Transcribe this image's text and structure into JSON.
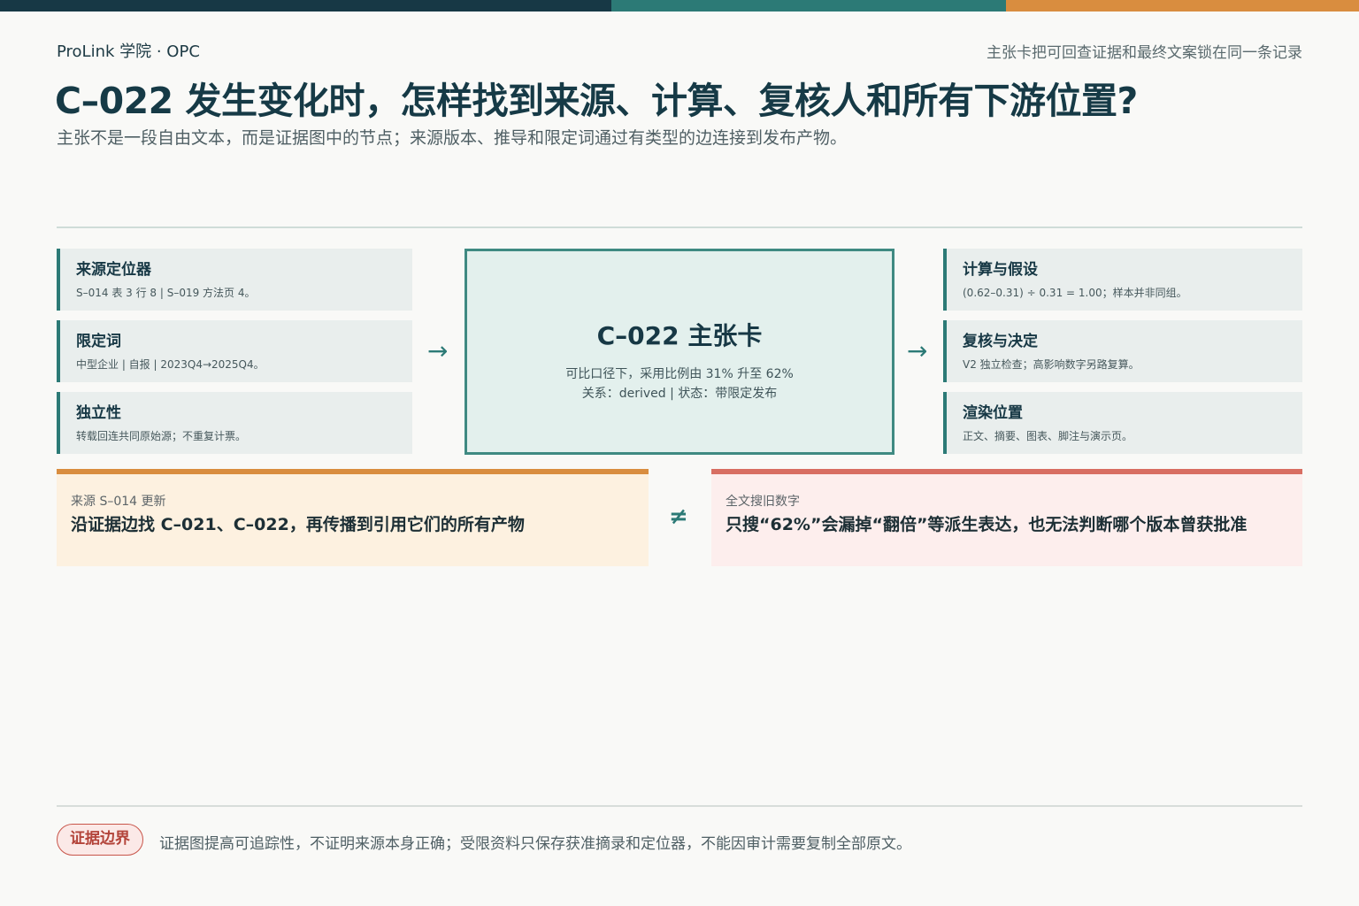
{
  "header": {
    "brand": "ProLink 学院 · OPC",
    "tagline": "主张卡把可回查证据和最终文案锁在同一条记录",
    "title": "C–022 发生变化时，怎样找到来源、计算、复核人和所有下游位置?",
    "subtitle": "主张不是一段自由文本，而是证据图中的节点；来源版本、推导和限定词通过有类型的边连接到发布产物。"
  },
  "colors": {
    "accent_dark": "#173845",
    "accent_teal": "#2c7a76",
    "accent_orange": "#d98d3f",
    "accent_red": "#d86e62"
  },
  "inputs": [
    {
      "title": "来源定位器",
      "desc": "S–014 表 3 行 8 | S–019 方法页 4。"
    },
    {
      "title": "限定词",
      "desc": "中型企业 | 自报 | 2023Q4→2025Q4。"
    },
    {
      "title": "独立性",
      "desc": "转载回连共同原始源；不重复计票。"
    }
  ],
  "outputs": [
    {
      "title": "计算与假设",
      "desc": "(0.62–0.31) ÷ 0.31 = 1.00；样本并非同组。"
    },
    {
      "title": "复核与决定",
      "desc": "V2 独立检查；高影响数字另路复算。"
    },
    {
      "title": "渲染位置",
      "desc": "正文、摘要、图表、脚注与演示页。"
    }
  ],
  "arrows": {
    "symbol": "→"
  },
  "claim_card": {
    "title": "C–022 主张卡",
    "line1": "可比口径下，采用比例由 31% 升至 62%",
    "line2": "关系：derived | 状态：带限定发布"
  },
  "comparison": {
    "left": {
      "label": "来源 S–014 更新",
      "text": "沿证据边找 C–021、C–022，再传播到引用它们的所有产物"
    },
    "symbol": "≠",
    "right": {
      "label": "全文搜旧数字",
      "text": "只搜“62%”会漏掉“翻倍”等派生表达，也无法判断哪个版本曾获批准"
    }
  },
  "footer": {
    "badge": "证据边界",
    "note": "证据图提高可追踪性，不证明来源本身正确；受限资料只保存获准摘录和定位器，不能因审计需要复制全部原文。"
  }
}
